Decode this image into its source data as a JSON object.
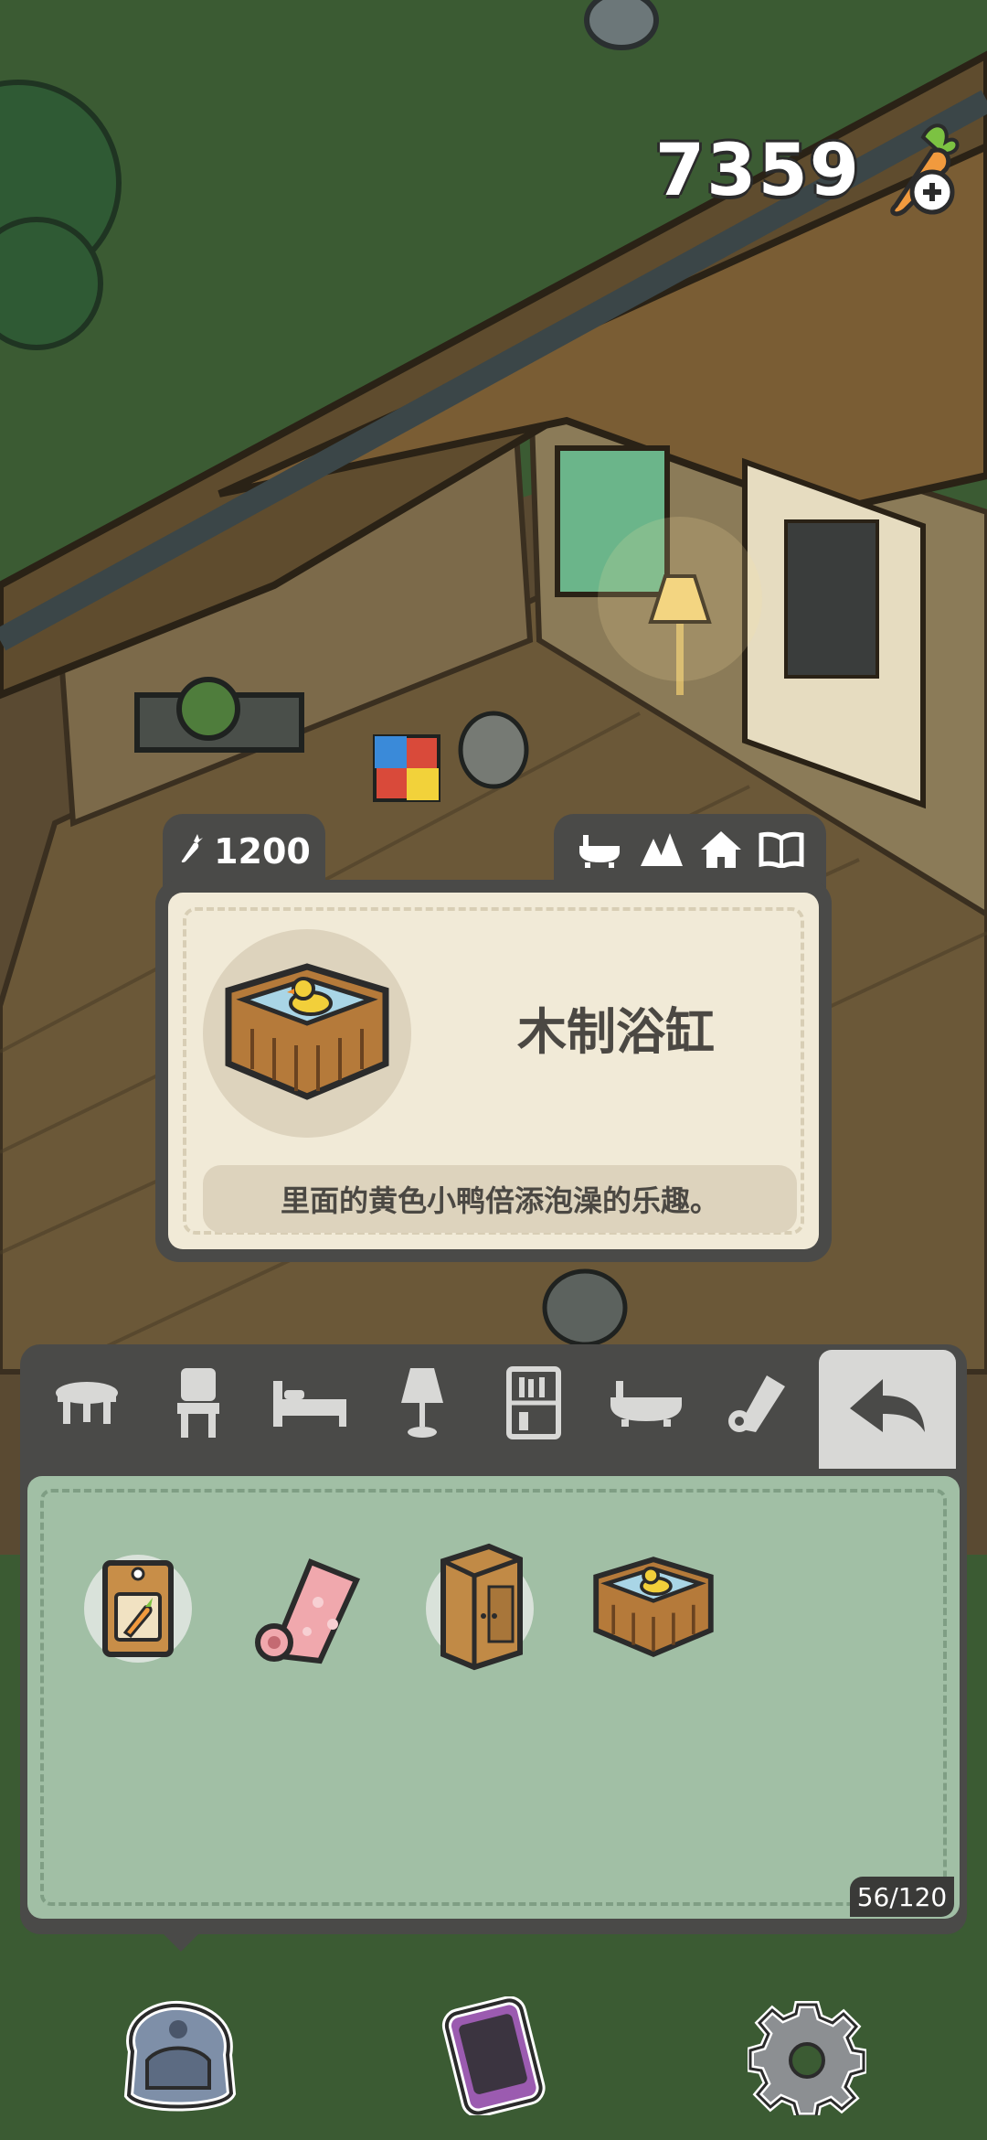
{
  "hud": {
    "currency_value": "7359",
    "currency_icon": "carrot-plus-icon"
  },
  "item_card": {
    "price": "1200",
    "price_icon": "carrot-icon",
    "category_icons": [
      "bathtub-icon",
      "outdoor-icon",
      "house-icon",
      "book-icon"
    ],
    "item_name": "木制浴缸",
    "item_icon": "wooden-bathtub-icon",
    "description": "里面的黄色小鸭倍添泡澡的乐趣。"
  },
  "inventory": {
    "category_tabs": [
      "table-icon",
      "chair-icon",
      "bed-icon",
      "lamp-icon",
      "shelf-icon",
      "bathtub-icon",
      "rug-icon"
    ],
    "back_icon": "back-arrow-icon",
    "items": [
      "seed-packet-icon",
      "pink-rug-icon",
      "wardrobe-icon",
      "wooden-bathtub-icon"
    ],
    "capacity": "56/120"
  },
  "bottom_nav": [
    "backpack-icon",
    "phone-icon",
    "settings-gear-icon"
  ],
  "colors": {
    "panel_dark": "#4a4a48",
    "card_cream": "#f1ead7",
    "inventory_green": "#a1bfa5",
    "grass": "#3a5a32"
  }
}
